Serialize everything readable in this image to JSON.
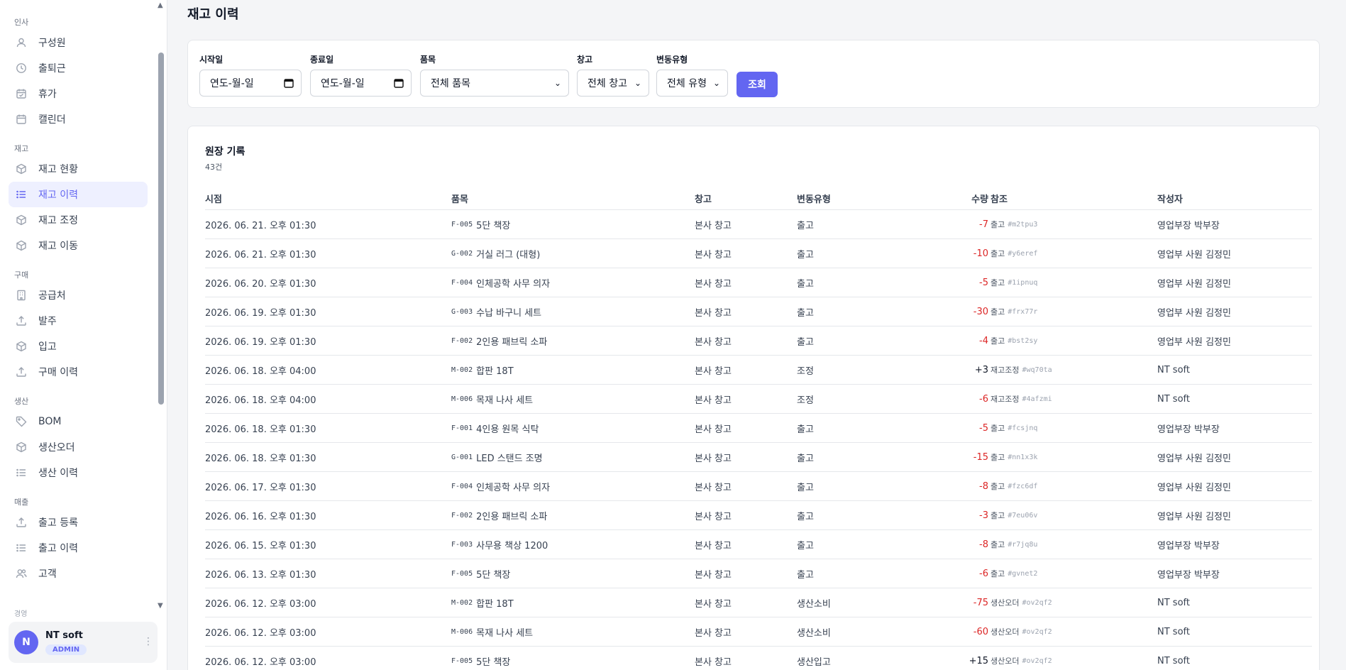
{
  "sidebar": {
    "sections": [
      {
        "title": "인사",
        "items": [
          {
            "label": "구성원",
            "icon": "user-icon"
          },
          {
            "label": "출퇴근",
            "icon": "clock-icon"
          },
          {
            "label": "휴가",
            "icon": "calendar-check-icon"
          },
          {
            "label": "캘린더",
            "icon": "calendar-icon"
          }
        ]
      },
      {
        "title": "재고",
        "items": [
          {
            "label": "재고 현황",
            "icon": "box-icon"
          },
          {
            "label": "재고 이력",
            "icon": "list-icon",
            "active": true
          },
          {
            "label": "재고 조정",
            "icon": "box-icon"
          },
          {
            "label": "재고 이동",
            "icon": "box-icon"
          }
        ]
      },
      {
        "title": "구매",
        "items": [
          {
            "label": "공급처",
            "icon": "building-icon"
          },
          {
            "label": "발주",
            "icon": "upload-icon"
          },
          {
            "label": "입고",
            "icon": "box-icon"
          },
          {
            "label": "구매 이력",
            "icon": "upload-icon"
          }
        ]
      },
      {
        "title": "생산",
        "items": [
          {
            "label": "BOM",
            "icon": "tag-icon"
          },
          {
            "label": "생산오더",
            "icon": "box-icon"
          },
          {
            "label": "생산 이력",
            "icon": "list-icon"
          }
        ]
      },
      {
        "title": "매출",
        "items": [
          {
            "label": "출고 등록",
            "icon": "upload-icon"
          },
          {
            "label": "출고 이력",
            "icon": "list-icon"
          },
          {
            "label": "고객",
            "icon": "users-icon"
          }
        ]
      }
    ],
    "cutoff_label": "경영",
    "user": {
      "initial": "N",
      "name": "NT soft",
      "role": "ADMIN",
      "menu": "⋮"
    }
  },
  "page_title": "재고 이력",
  "filters": {
    "start_label": "시작일",
    "start_value": "연도-월-일",
    "end_label": "종료일",
    "end_value": "연도-월-일",
    "item_label": "품목",
    "item_value": "전체 품목",
    "warehouse_label": "창고",
    "warehouse_value": "전체 창고",
    "type_label": "변동유형",
    "type_value": "전체 유형",
    "search_button": "조회"
  },
  "ledger": {
    "title": "원장 기록",
    "count": "43건",
    "columns": [
      "시점",
      "품목",
      "창고",
      "변동유형",
      "수량",
      "참조",
      "작성자"
    ],
    "rows": [
      {
        "time": "2026. 06. 21. 오후 01:30",
        "code": "F-005",
        "item": "5단 책장",
        "warehouse": "본사 창고",
        "type": "출고",
        "qty": "-7",
        "ref_label": "출고",
        "ref": "#m2tpu3",
        "user": "영업부장 박부장"
      },
      {
        "time": "2026. 06. 21. 오후 01:30",
        "code": "G-002",
        "item": "거실 러그 (대형)",
        "warehouse": "본사 창고",
        "type": "출고",
        "qty": "-10",
        "ref_label": "출고",
        "ref": "#y6eref",
        "user": "영업부 사원 김정민"
      },
      {
        "time": "2026. 06. 20. 오후 01:30",
        "code": "F-004",
        "item": "인체공학 사무 의자",
        "warehouse": "본사 창고",
        "type": "출고",
        "qty": "-5",
        "ref_label": "출고",
        "ref": "#1ipnuq",
        "user": "영업부 사원 김정민"
      },
      {
        "time": "2026. 06. 19. 오후 01:30",
        "code": "G-003",
        "item": "수납 바구니 세트",
        "warehouse": "본사 창고",
        "type": "출고",
        "qty": "-30",
        "ref_label": "출고",
        "ref": "#frx77r",
        "user": "영업부 사원 김정민"
      },
      {
        "time": "2026. 06. 19. 오후 01:30",
        "code": "F-002",
        "item": "2인용 패브릭 소파",
        "warehouse": "본사 창고",
        "type": "출고",
        "qty": "-4",
        "ref_label": "출고",
        "ref": "#bst2sy",
        "user": "영업부 사원 김정민"
      },
      {
        "time": "2026. 06. 18. 오후 04:00",
        "code": "M-002",
        "item": "합판 18T",
        "warehouse": "본사 창고",
        "type": "조정",
        "qty": "+3",
        "ref_label": "재고조정",
        "ref": "#wq70ta",
        "user": "NT soft"
      },
      {
        "time": "2026. 06. 18. 오후 04:00",
        "code": "M-006",
        "item": "목재 나사 세트",
        "warehouse": "본사 창고",
        "type": "조정",
        "qty": "-6",
        "ref_label": "재고조정",
        "ref": "#4afzmi",
        "user": "NT soft"
      },
      {
        "time": "2026. 06. 18. 오후 01:30",
        "code": "F-001",
        "item": "4인용 원목 식탁",
        "warehouse": "본사 창고",
        "type": "출고",
        "qty": "-5",
        "ref_label": "출고",
        "ref": "#fcsjnq",
        "user": "영업부장 박부장"
      },
      {
        "time": "2026. 06. 18. 오후 01:30",
        "code": "G-001",
        "item": "LED 스탠드 조명",
        "warehouse": "본사 창고",
        "type": "출고",
        "qty": "-15",
        "ref_label": "출고",
        "ref": "#nn1x3k",
        "user": "영업부 사원 김정민"
      },
      {
        "time": "2026. 06. 17. 오후 01:30",
        "code": "F-004",
        "item": "인체공학 사무 의자",
        "warehouse": "본사 창고",
        "type": "출고",
        "qty": "-8",
        "ref_label": "출고",
        "ref": "#fzc6df",
        "user": "영업부 사원 김정민"
      },
      {
        "time": "2026. 06. 16. 오후 01:30",
        "code": "F-002",
        "item": "2인용 패브릭 소파",
        "warehouse": "본사 창고",
        "type": "출고",
        "qty": "-3",
        "ref_label": "출고",
        "ref": "#7eu06v",
        "user": "영업부 사원 김정민"
      },
      {
        "time": "2026. 06. 15. 오후 01:30",
        "code": "F-003",
        "item": "사무용 책상 1200",
        "warehouse": "본사 창고",
        "type": "출고",
        "qty": "-8",
        "ref_label": "출고",
        "ref": "#r7jq8u",
        "user": "영업부장 박부장"
      },
      {
        "time": "2026. 06. 13. 오후 01:30",
        "code": "F-005",
        "item": "5단 책장",
        "warehouse": "본사 창고",
        "type": "출고",
        "qty": "-6",
        "ref_label": "출고",
        "ref": "#gvnet2",
        "user": "영업부장 박부장"
      },
      {
        "time": "2026. 06. 12. 오후 03:00",
        "code": "M-002",
        "item": "합판 18T",
        "warehouse": "본사 창고",
        "type": "생산소비",
        "qty": "-75",
        "ref_label": "생산오더",
        "ref": "#ov2qf2",
        "user": "NT soft"
      },
      {
        "time": "2026. 06. 12. 오후 03:00",
        "code": "M-006",
        "item": "목재 나사 세트",
        "warehouse": "본사 창고",
        "type": "생산소비",
        "qty": "-60",
        "ref_label": "생산오더",
        "ref": "#ov2qf2",
        "user": "NT soft"
      },
      {
        "time": "2026. 06. 12. 오후 03:00",
        "code": "F-005",
        "item": "5단 책장",
        "warehouse": "본사 창고",
        "type": "생산입고",
        "qty": "+15",
        "ref_label": "생산오더",
        "ref": "#ov2qf2",
        "user": "NT soft"
      }
    ]
  },
  "colors": {
    "accent": "#6366f1",
    "negative": "#dc2626"
  }
}
